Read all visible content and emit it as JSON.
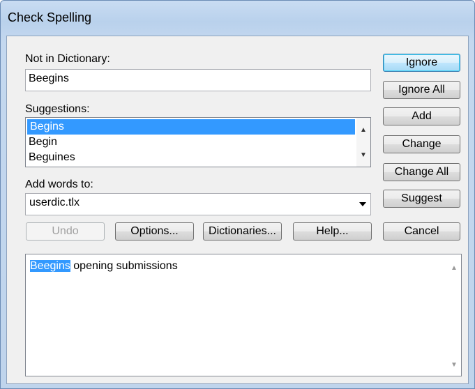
{
  "window": {
    "title": "Check Spelling"
  },
  "not_in_dictionary": {
    "label": "Not in Dictionary:",
    "value": "Beegins"
  },
  "suggestions": {
    "label": "Suggestions:",
    "items": [
      "Begins",
      "Begin",
      "Beguines"
    ],
    "selected_index": 0
  },
  "add_words_to": {
    "label": "Add words to:",
    "value": "userdic.tlx"
  },
  "buttons": {
    "ignore": "Ignore",
    "ignore_all": "Ignore All",
    "add": "Add",
    "change": "Change",
    "change_all": "Change All",
    "suggest": "Suggest",
    "undo": "Undo",
    "options": "Options...",
    "dictionaries": "Dictionaries...",
    "help": "Help...",
    "cancel": "Cancel"
  },
  "preview": {
    "highlighted_word": "Beegins",
    "rest_text": " opening submissions"
  },
  "icons": {
    "scroll_up": "scroll-up-arrow-icon",
    "scroll_down": "scroll-down-arrow-icon",
    "dropdown": "chevron-down-icon"
  },
  "colors": {
    "selection": "#3399ff",
    "titlebar": "#b9d1ec"
  }
}
